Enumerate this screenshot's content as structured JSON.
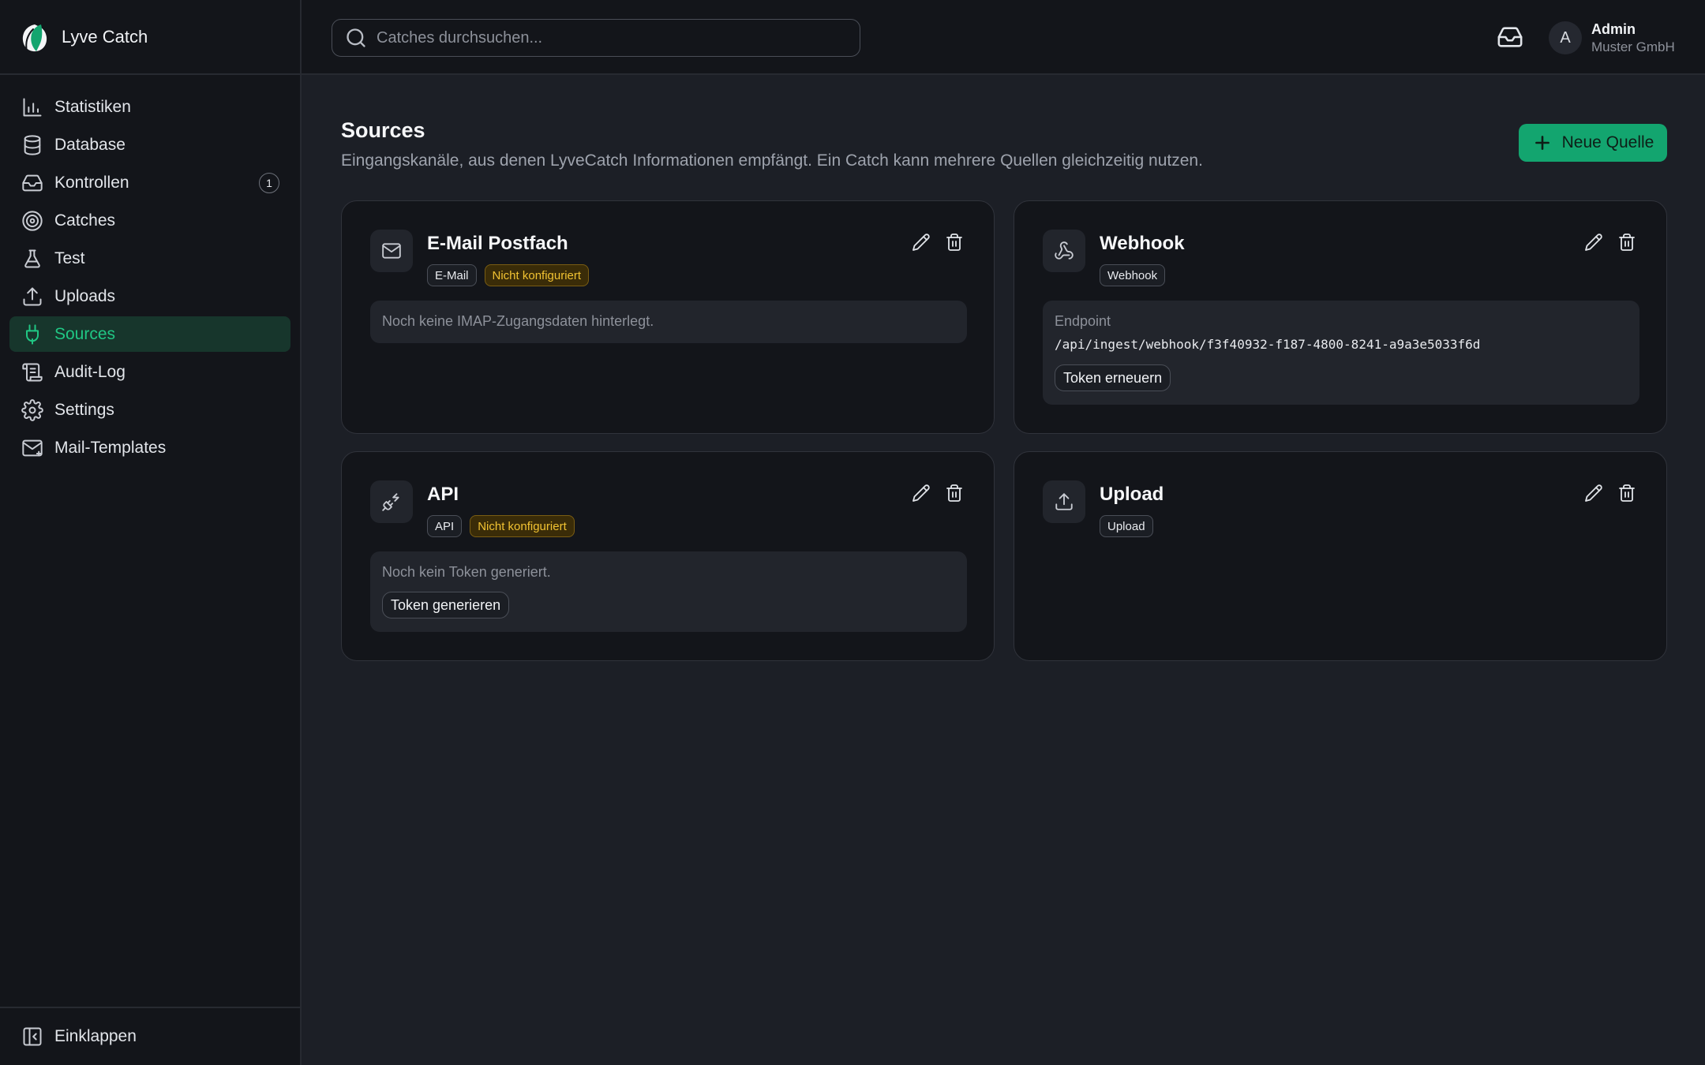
{
  "brand": {
    "name": "Lyve Catch",
    "accent": "#13a56f"
  },
  "sidebar": {
    "items": [
      {
        "label": "Statistiken",
        "icon": "bar-chart-icon"
      },
      {
        "label": "Database",
        "icon": "database-icon"
      },
      {
        "label": "Kontrollen",
        "icon": "inbox-icon",
        "badge": "1"
      },
      {
        "label": "Catches",
        "icon": "target-icon"
      },
      {
        "label": "Test",
        "icon": "flask-icon"
      },
      {
        "label": "Uploads",
        "icon": "upload-icon"
      },
      {
        "label": "Sources",
        "icon": "plug-icon",
        "active": true
      },
      {
        "label": "Audit-Log",
        "icon": "scroll-icon"
      },
      {
        "label": "Settings",
        "icon": "gear-icon"
      },
      {
        "label": "Mail-Templates",
        "icon": "mail-icon"
      }
    ],
    "collapse_label": "Einklappen"
  },
  "topbar": {
    "search_placeholder": "Catches durchsuchen...",
    "user": {
      "initial": "A",
      "name": "Admin",
      "org": "Muster GmbH"
    }
  },
  "page": {
    "title": "Sources",
    "description": "Eingangskanäle, aus denen LyveCatch Informationen empfängt. Ein Catch kann mehrere Quellen gleichzeitig nutzen.",
    "new_button": "Neue Quelle"
  },
  "sources": [
    {
      "title": "E-Mail Postfach",
      "icon": "mail-icon",
      "tags": [
        "E-Mail",
        "Nicht konfiguriert"
      ],
      "info": "Noch keine IMAP-Zugangsdaten hinterlegt."
    },
    {
      "title": "Webhook",
      "icon": "webhook-icon",
      "tags": [
        "Webhook"
      ],
      "info_label": "Endpoint",
      "endpoint": "/api/ingest/webhook/f3f40932-f187-4800-8241-a9a3e5033f6d",
      "button": "Token erneuern"
    },
    {
      "title": "API",
      "icon": "plug-zap-icon",
      "tags": [
        "API",
        "Nicht konfiguriert"
      ],
      "info": "Noch kein Token generiert.",
      "button": "Token generieren"
    },
    {
      "title": "Upload",
      "icon": "upload-icon",
      "tags": [
        "Upload"
      ]
    }
  ]
}
